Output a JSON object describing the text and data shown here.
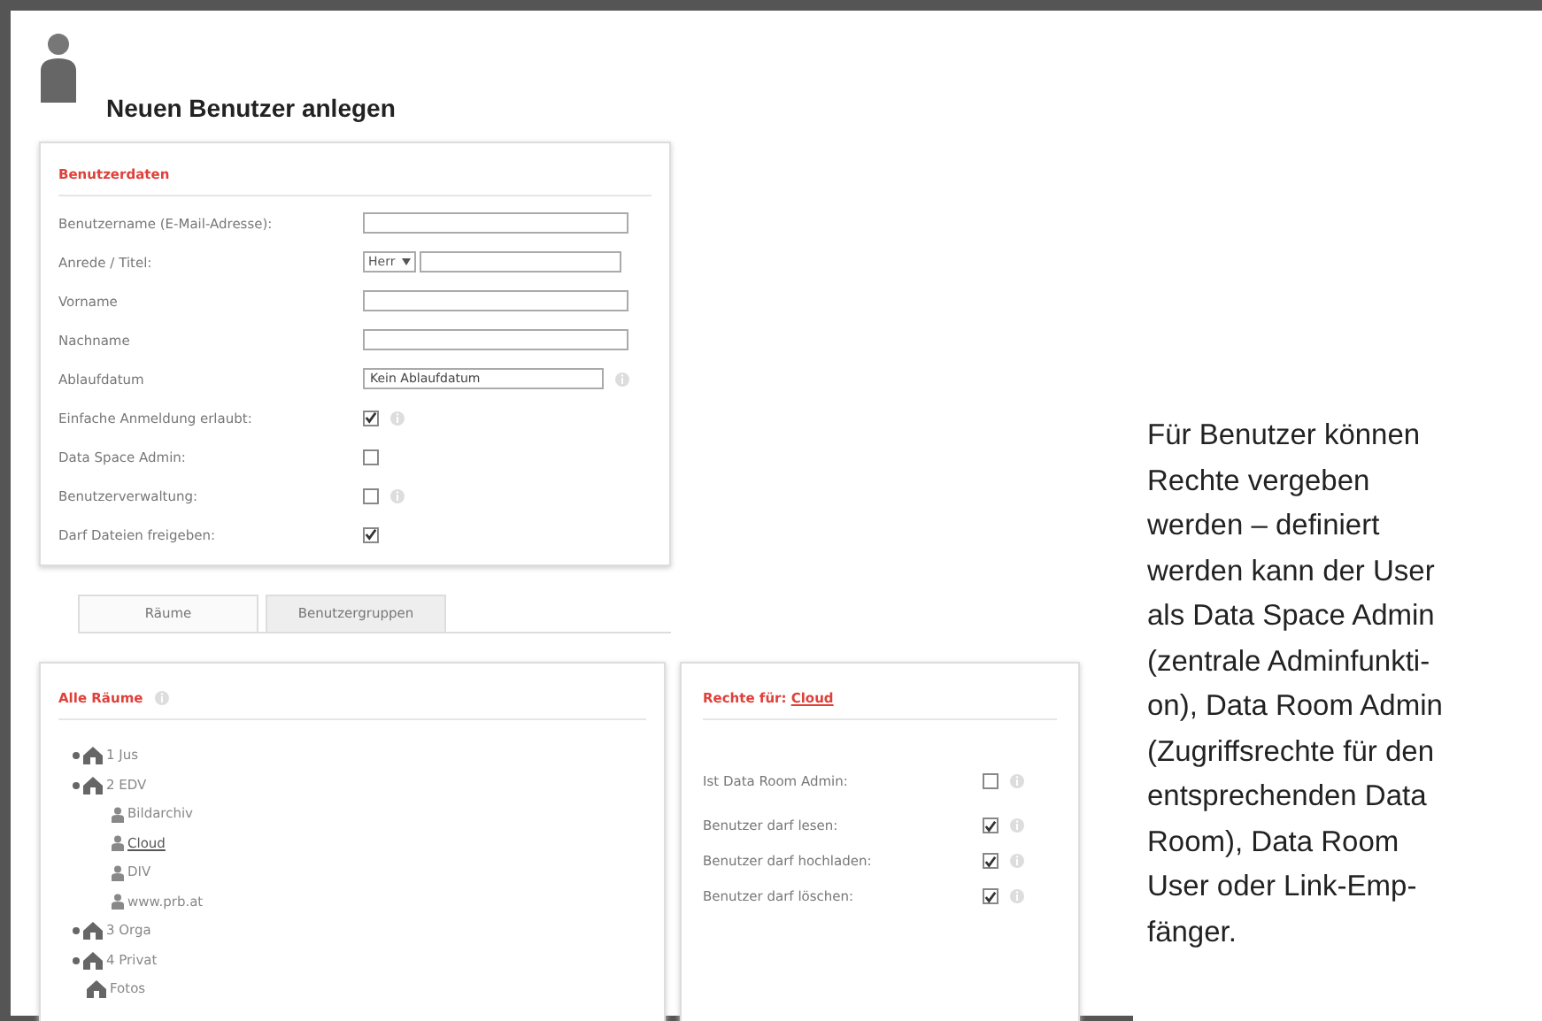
{
  "page": {
    "title": "Neuen Benutzer anlegen"
  },
  "user_data": {
    "heading": "Benutzerdaten",
    "rows": [
      {
        "kind": "text",
        "label": "Benutzername (E-Mail-Adresse):",
        "info": false
      },
      {
        "kind": "salutation",
        "label": "Anrede / Titel:",
        "select": "Herr",
        "info": false
      },
      {
        "kind": "text",
        "label": "Vorname",
        "info": false
      },
      {
        "kind": "text",
        "label": "Nachname",
        "info": false
      },
      {
        "kind": "date",
        "label": "Ablaufdatum",
        "value": "Kein Ablaufdatum",
        "info": true
      },
      {
        "kind": "check",
        "label": "Einfache Anmeldung erlaubt:",
        "checked": true,
        "info": true
      },
      {
        "kind": "check",
        "label": "Data Space Admin:",
        "checked": false,
        "info": false
      },
      {
        "kind": "check",
        "label": "Benutzerverwaltung:",
        "checked": false,
        "info": true
      },
      {
        "kind": "check",
        "label": "Darf Dateien freigeben:",
        "checked": true,
        "info": false
      }
    ]
  },
  "tabs": [
    {
      "label": "Räume",
      "selected": true
    },
    {
      "label": "Benutzergruppen",
      "selected": false
    }
  ],
  "rooms": {
    "heading": "Alle Räume",
    "tree": [
      {
        "label": "1 Jus",
        "kind": "room",
        "selected": false
      },
      {
        "label": "2 EDV",
        "kind": "room",
        "selected": false,
        "children": [
          {
            "label": "Bildarchiv",
            "kind": "user",
            "selected": false
          },
          {
            "label": "Cloud",
            "kind": "user",
            "selected": true
          },
          {
            "label": "DIV",
            "kind": "user",
            "selected": false
          },
          {
            "label": "www.prb.at",
            "kind": "user",
            "selected": false
          }
        ]
      },
      {
        "label": "3 Orga",
        "kind": "room",
        "selected": false
      },
      {
        "label": "4 Privat",
        "kind": "room",
        "selected": false
      },
      {
        "label": "Fotos",
        "kind": "leaf-room",
        "selected": false
      }
    ]
  },
  "rights": {
    "heading": "Rechte für:",
    "room": "Cloud",
    "rows": [
      {
        "label": "Ist Data Room Admin:",
        "checked": false
      },
      {
        "label": "Benutzer darf lesen:",
        "checked": true
      },
      {
        "label": "Benutzer darf hochladen:",
        "checked": true
      },
      {
        "label": "Benutzer darf löschen:",
        "checked": true
      }
    ]
  },
  "caption": {
    "lines": [
      "Für Benutzer können",
      "Rechte vergeben",
      "werden – definiert",
      "werden kann der User",
      "als Data Space Admin",
      "(zentrale Adminfunkti-",
      "on), Data Room Admin",
      "(Zugriffsrechte für den",
      "entsprechenden Data",
      "Room), Data Room",
      "User oder Link-Emp-",
      "fänger."
    ]
  }
}
